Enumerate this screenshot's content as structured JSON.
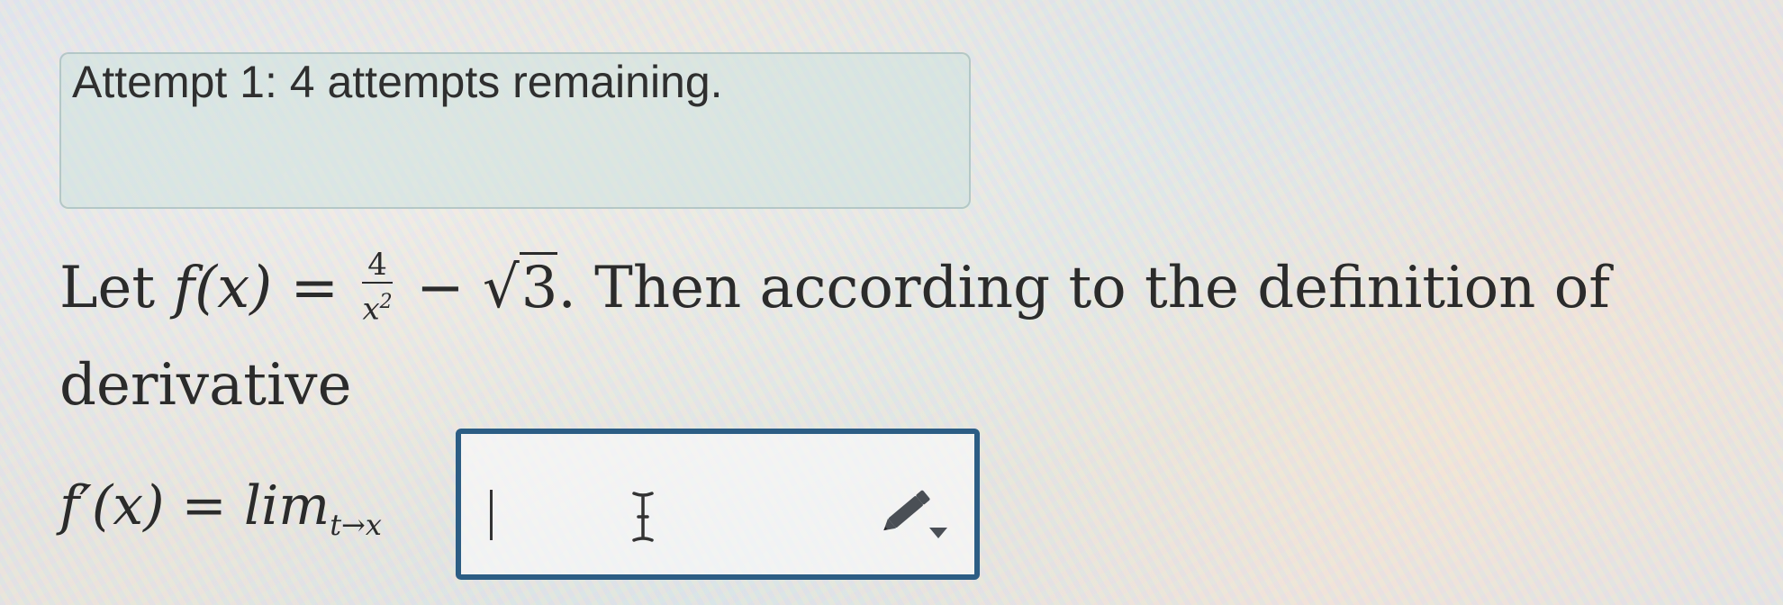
{
  "attempt": {
    "text": "Attempt 1: 4 attempts remaining."
  },
  "question": {
    "let": "Let",
    "fx": "f(x)",
    "equals": "=",
    "frac_num": "4",
    "frac_den_base": "x",
    "frac_den_exp": "2",
    "minus": "−",
    "sqrt_symbol": "√",
    "sqrt_value": "3",
    "rest": ". Then according to the definition of",
    "line2": "derivative"
  },
  "derivative": {
    "lhs": "f′(x) = lim",
    "subscript": "t→x"
  },
  "answer_input": {
    "value": "",
    "icon": "pencil-dropdown-icon"
  }
}
